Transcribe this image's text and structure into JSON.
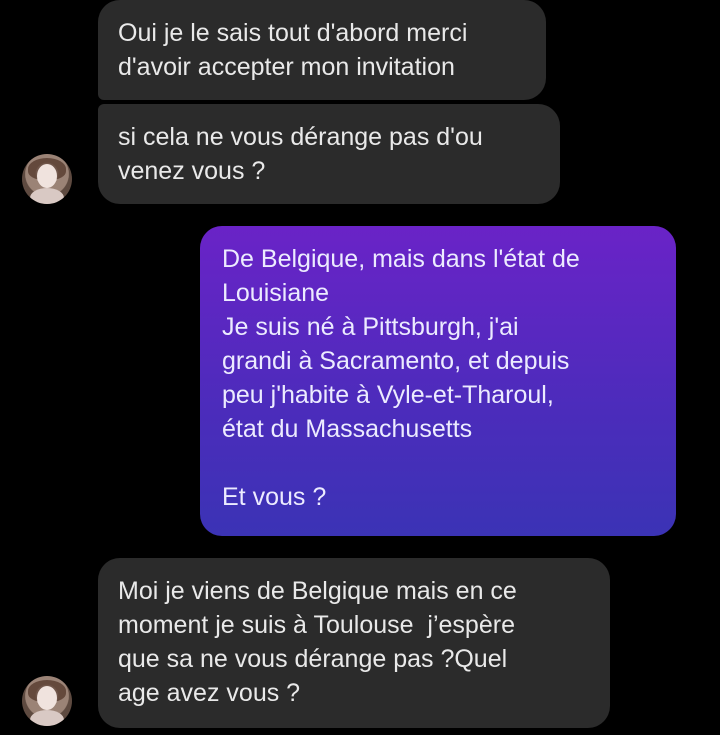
{
  "messages": [
    {
      "text": "Oui je le sais tout d'abord merci\nd'avoir accepter mon invitation"
    },
    {
      "text": "si cela ne vous dérange pas d'ou\nvenez vous ?"
    },
    {
      "text": "De Belgique, mais dans l'état de\nLouisiane\nJe suis né à Pittsburgh, j'ai\ngrandi à Sacramento, et depuis\npeu j'habite à Vyle-et-Tharoul,\nétat du Massachusetts\n\nEt vous ?"
    },
    {
      "text": "Moi je viens de Belgique mais en ce\nmoment je suis à Toulouse  j’espère\nque sa ne vous dérange pas ?Quel\nage avez vous ?"
    }
  ]
}
